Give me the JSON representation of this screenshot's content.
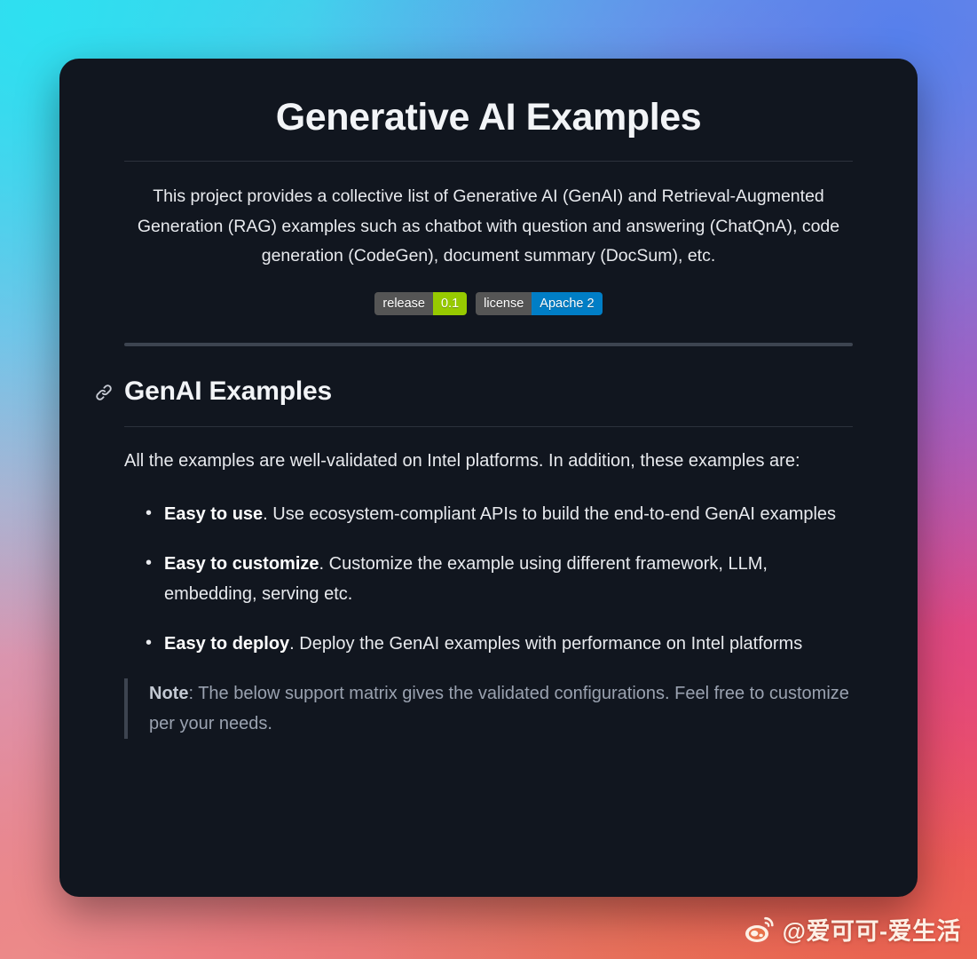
{
  "page": {
    "title": "Generative AI Examples",
    "intro": "This project provides a collective list of Generative AI (GenAI) and Retrieval-Augmented Generation (RAG) examples such as chatbot with question and answering (ChatQnA), code generation (CodeGen), document summary (DocSum), etc."
  },
  "badges": [
    {
      "name": "release-badge",
      "label": "release",
      "value": "0.1",
      "label_color": "#555555",
      "value_color": "#97ca00"
    },
    {
      "name": "license-badge",
      "label": "license",
      "value": "Apache 2",
      "label_color": "#555555",
      "value_color": "#007ec6"
    }
  ],
  "section": {
    "anchor_icon": "link-anchor-icon",
    "heading": "GenAI Examples",
    "paragraph": "All the examples are well-validated on Intel platforms. In addition, these examples are:",
    "items": [
      {
        "strong": "Easy to use",
        "rest": ". Use ecosystem-compliant APIs to build the end-to-end GenAI examples"
      },
      {
        "strong": "Easy to customize",
        "rest": ". Customize the example using different framework, LLM, embedding, serving etc."
      },
      {
        "strong": "Easy to deploy",
        "rest": ". Deploy the GenAI examples with performance on Intel platforms"
      }
    ],
    "note": {
      "label": "Note",
      "text": ": The below support matrix gives the validated configurations. Feel free to customize per your needs."
    }
  },
  "watermark": {
    "icon": "weibo-logo-icon",
    "handle": "@爱可可-爱生活"
  },
  "theme": {
    "card_background": "#11161f",
    "text_primary": "#e8eaee",
    "text_muted": "#9aa2b0",
    "divider": "#3d4450",
    "backdrop_top_left": "#2ee0f0",
    "backdrop_top_right": "#5680ec",
    "backdrop_right_mid": "#d04aa8",
    "backdrop_bottom_right": "#e8714a",
    "backdrop_bottom_left": "#ec8a89",
    "backdrop_left_mid": "#c9aede"
  }
}
